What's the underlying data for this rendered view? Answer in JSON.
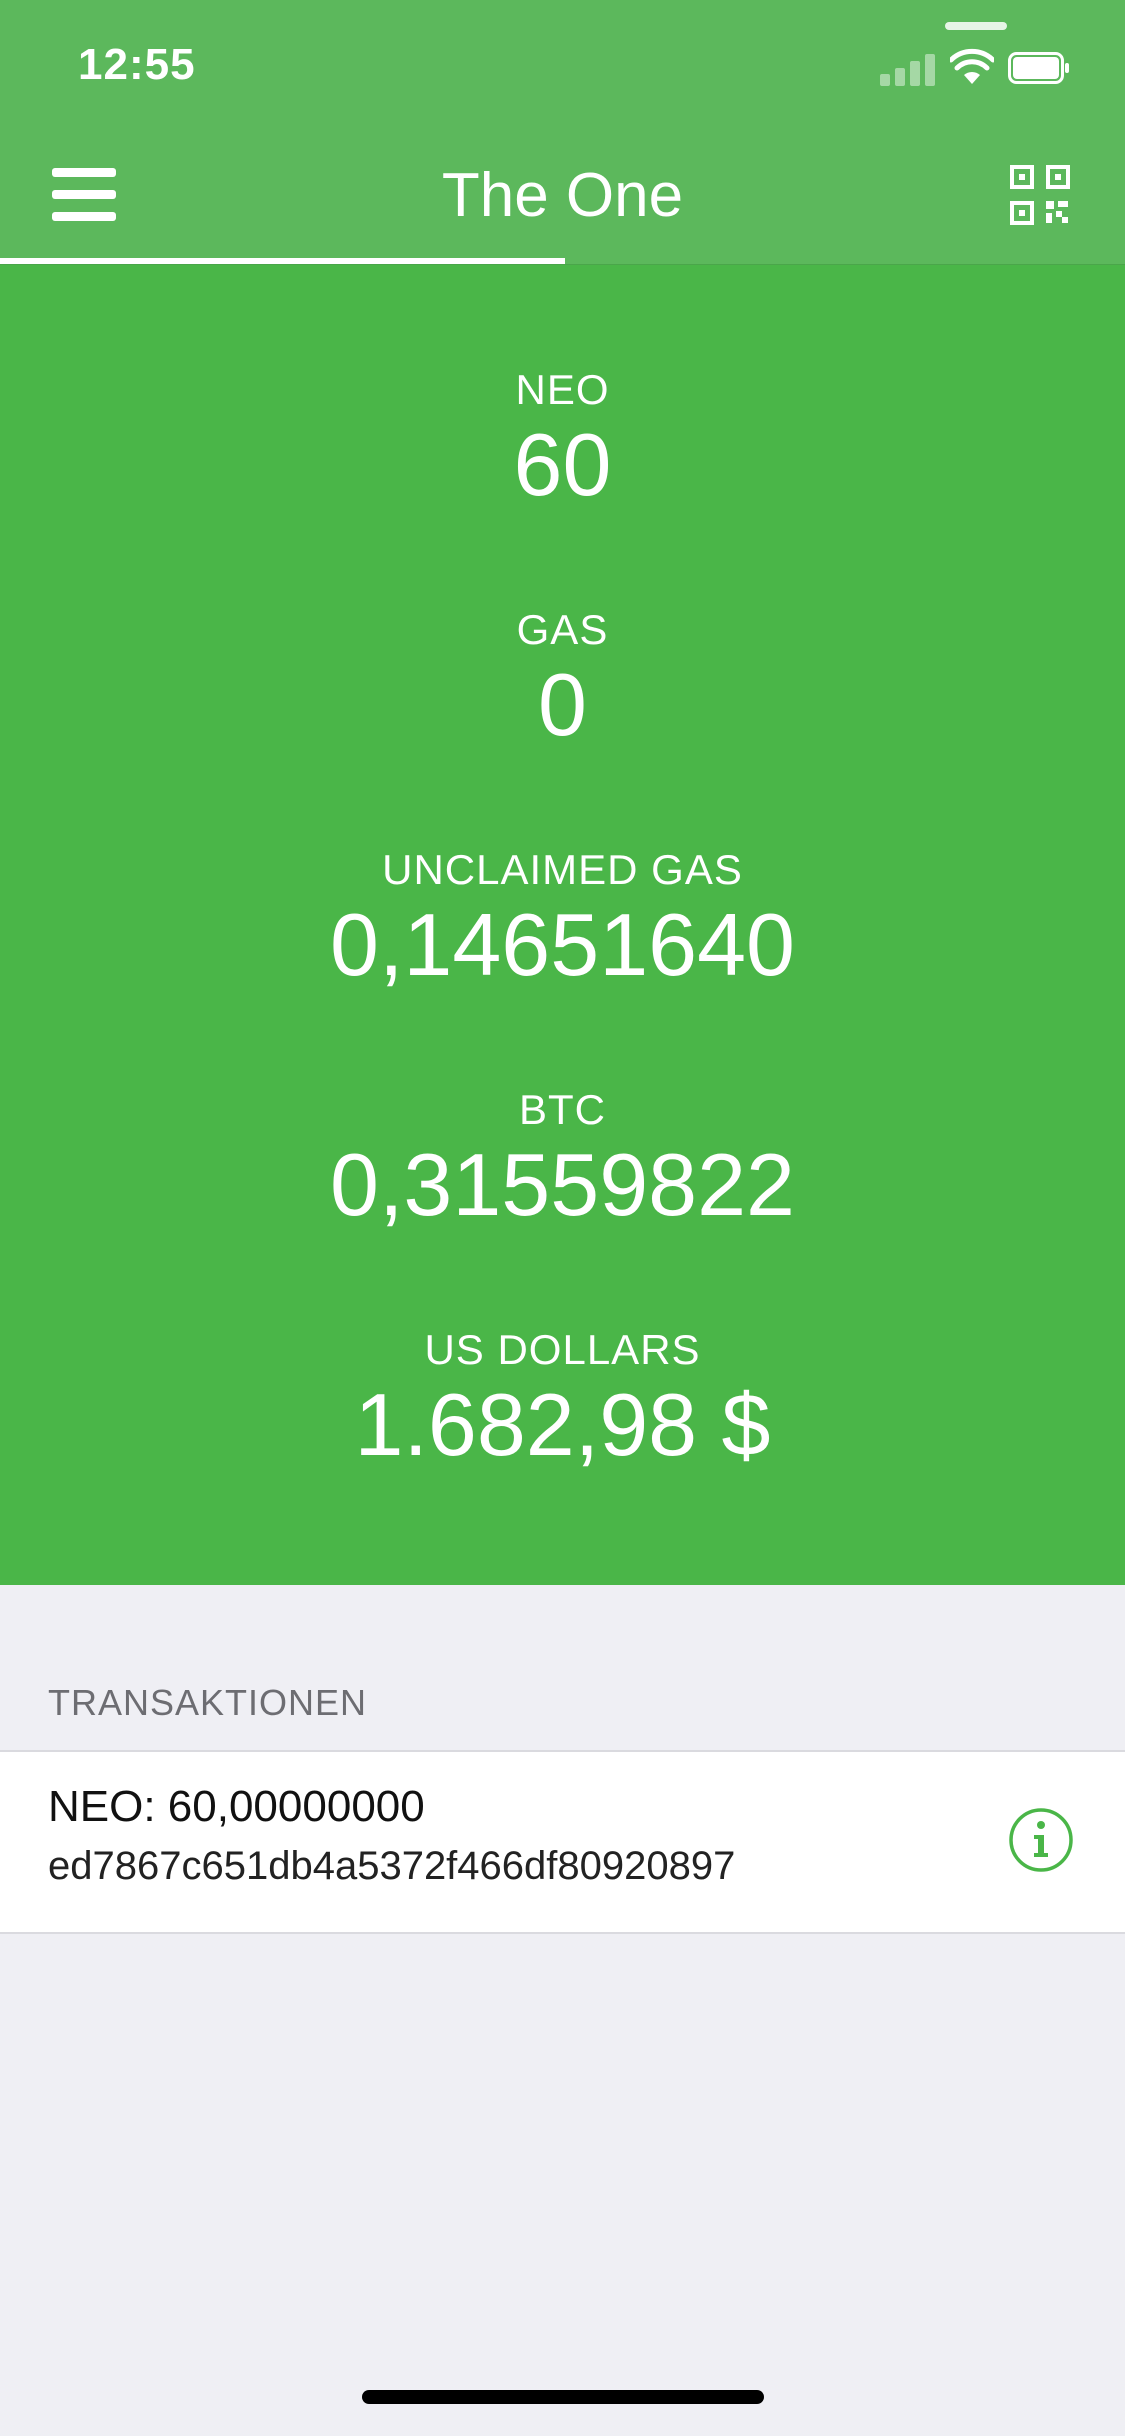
{
  "status_bar": {
    "time": "12:55"
  },
  "nav": {
    "title": "The One",
    "menu_icon": "hamburger-menu-icon",
    "qr_icon": "qr-code-icon"
  },
  "balances": [
    {
      "label": "NEO",
      "value": "60"
    },
    {
      "label": "GAS",
      "value": "0"
    },
    {
      "label": "UNCLAIMED GAS",
      "value": "0,14651640"
    },
    {
      "label": "BTC",
      "value": "0,31559822"
    },
    {
      "label": "US DOLLARS",
      "value": "1.682,98 $"
    }
  ],
  "transactions": {
    "header": "TRANSAKTIONEN",
    "items": [
      {
        "amount": "NEO: 60,00000000",
        "hash": "ed7867c651db4a5372f466df80920897",
        "info_icon": "info-icon"
      }
    ]
  },
  "colors": {
    "nav_green": "#5cb85c",
    "panel_green": "#4ab648",
    "accent_green": "#4ab648",
    "background": "#efeff4"
  }
}
